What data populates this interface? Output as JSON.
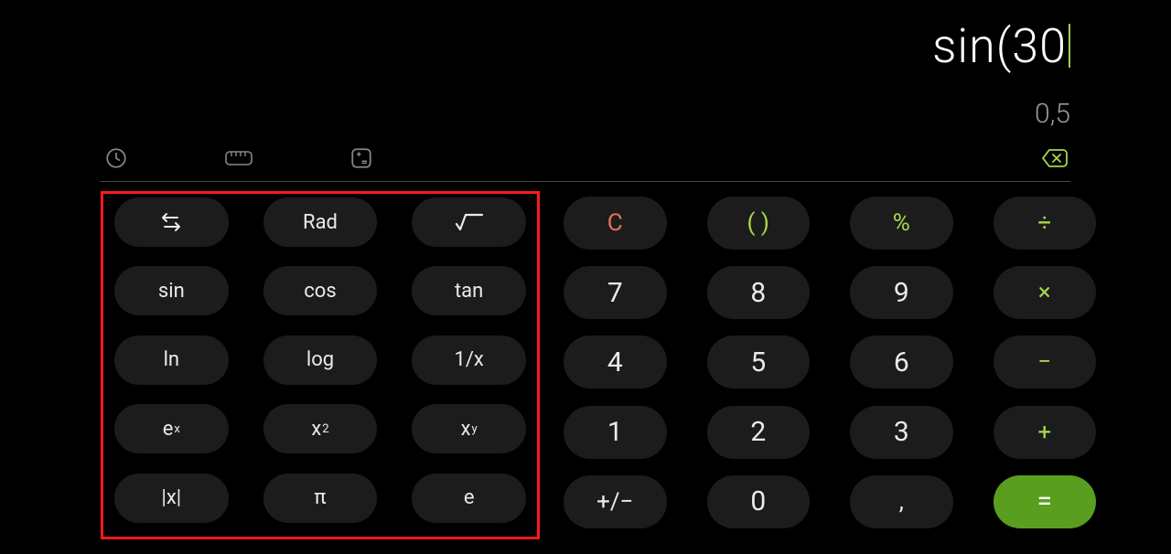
{
  "display": {
    "expression": "sin(30",
    "result": "0,5"
  },
  "toolbar": {
    "history": "history-icon",
    "ruler": "ruler-icon",
    "calc": "calculator-icon",
    "backspace": "backspace-icon"
  },
  "scientific": {
    "swap": "swap",
    "rad": "Rad",
    "sqrt": "√",
    "sin": "sin",
    "cos": "cos",
    "tan": "tan",
    "ln": "ln",
    "log": "log",
    "recip": "1/x",
    "ex_base": "e",
    "ex_sup": "x",
    "x2_base": "x",
    "x2_sup": "2",
    "xy_base": "x",
    "xy_sup": "y",
    "abs": "|x|",
    "pi": "π",
    "e": "e"
  },
  "main": {
    "clear": "C",
    "paren": "( )",
    "percent": "%",
    "divide": "÷",
    "n7": "7",
    "n8": "8",
    "n9": "9",
    "multiply": "×",
    "n4": "4",
    "n5": "5",
    "n6": "6",
    "minus": "−",
    "n1": "1",
    "n2": "2",
    "n3": "3",
    "plus": "+",
    "sign": "+/−",
    "n0": "0",
    "comma": ",",
    "equals": "="
  }
}
